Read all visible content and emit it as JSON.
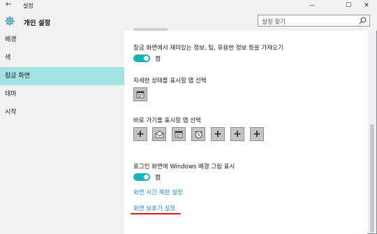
{
  "window": {
    "title": "설정",
    "back_glyph": "←",
    "minimize_glyph": "—",
    "maximize_glyph": "☐",
    "close_glyph": "✕"
  },
  "header": {
    "page_title": "개인 설정",
    "icon": "gear-icon",
    "search_placeholder": "설정 찾기"
  },
  "sidebar": {
    "items": [
      {
        "label": "배경"
      },
      {
        "label": "색"
      },
      {
        "label": "잠금 화면",
        "active": true
      },
      {
        "label": "테마"
      },
      {
        "label": "시작"
      }
    ]
  },
  "content": {
    "fun_facts_label": "잠금 화면에서 재미있는 정보, 팁, 유용한 정보 등을 가져오기",
    "fun_facts_state": "켬",
    "detail_label": "자세한 상태를 표시할 앱 선택",
    "quick_label": "바로 가기를 표시할 앱 선택",
    "bg_label": "로그인 화면에 Windows 배경 그림 표시",
    "bg_state": "켬",
    "screen_timeout_link": "화면 시간 제한 설정",
    "screensaver_link": "화면 보호기 설정"
  },
  "colors": {
    "accent": "#1ab5b8",
    "active_nav": "#a4e1e1",
    "link": "#1d8ec9",
    "annotation": "#e0141e"
  }
}
